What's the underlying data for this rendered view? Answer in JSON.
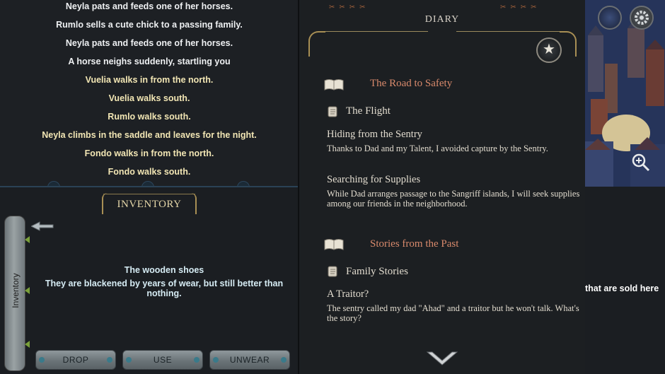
{
  "log": {
    "lines": [
      {
        "text": "Neyla pats and feeds one of her horses.",
        "tone": "white"
      },
      {
        "text": "Rumlo sells a cute chick to a passing family.",
        "tone": "white"
      },
      {
        "text": "Neyla pats and feeds one of her horses.",
        "tone": "white"
      },
      {
        "text": "A horse neighs suddenly, startling you",
        "tone": "white"
      },
      {
        "text": "Vuelia walks in from the north.",
        "tone": "yellow"
      },
      {
        "text": "Vuelia walks south.",
        "tone": "yellow"
      },
      {
        "text": "Rumlo walks south.",
        "tone": "yellow"
      },
      {
        "text": "Neyla climbs in the saddle and leaves for the night.",
        "tone": "yellow"
      },
      {
        "text": "Fondo walks in from the north.",
        "tone": "yellow"
      },
      {
        "text": "Fondo walks south.",
        "tone": "yellow"
      }
    ]
  },
  "inventory": {
    "title": "INVENTORY",
    "tab_label": "Inventory",
    "item_name": "The wooden shoes",
    "item_description": "They are blackened by years of wear, but still better than nothing.",
    "buttons": {
      "drop": "DROP",
      "use": "USE",
      "unwear": "UNWEAR"
    }
  },
  "diary": {
    "title": "DIARY",
    "sections": [
      {
        "title": "The Road to Safety",
        "chapter": "The Flight",
        "entries": [
          {
            "title": "Hiding from the Sentry",
            "text": "Thanks to Dad and my Talent, I avoided capture by the Sentry."
          },
          {
            "title": "Searching for Supplies",
            "text": "While Dad arranges passage to the Sangriff islands, I will seek supplies among our friends in the neighborhood."
          }
        ]
      },
      {
        "title": "Stories from the Past",
        "chapter": "Family Stories",
        "entries": [
          {
            "title": "A Traitor?",
            "text": "The sentry called my dad \"Ahad\" and a traitor but he won't talk. What's the story?"
          }
        ]
      }
    ]
  },
  "map": {
    "side_text": "that are sold here"
  },
  "colors": {
    "log_white": "#eef0f2",
    "log_yellow": "#f2e6b4",
    "diary_section": "#d98a6c",
    "diary_text": "#e2dccf",
    "accent_gold": "#a88f54"
  },
  "icons": [
    "arrow-left-icon",
    "book-icon",
    "scroll-icon",
    "star-icon",
    "chevron-down-icon",
    "gear-icon",
    "zoom-in-icon",
    "map-globe-icon"
  ]
}
